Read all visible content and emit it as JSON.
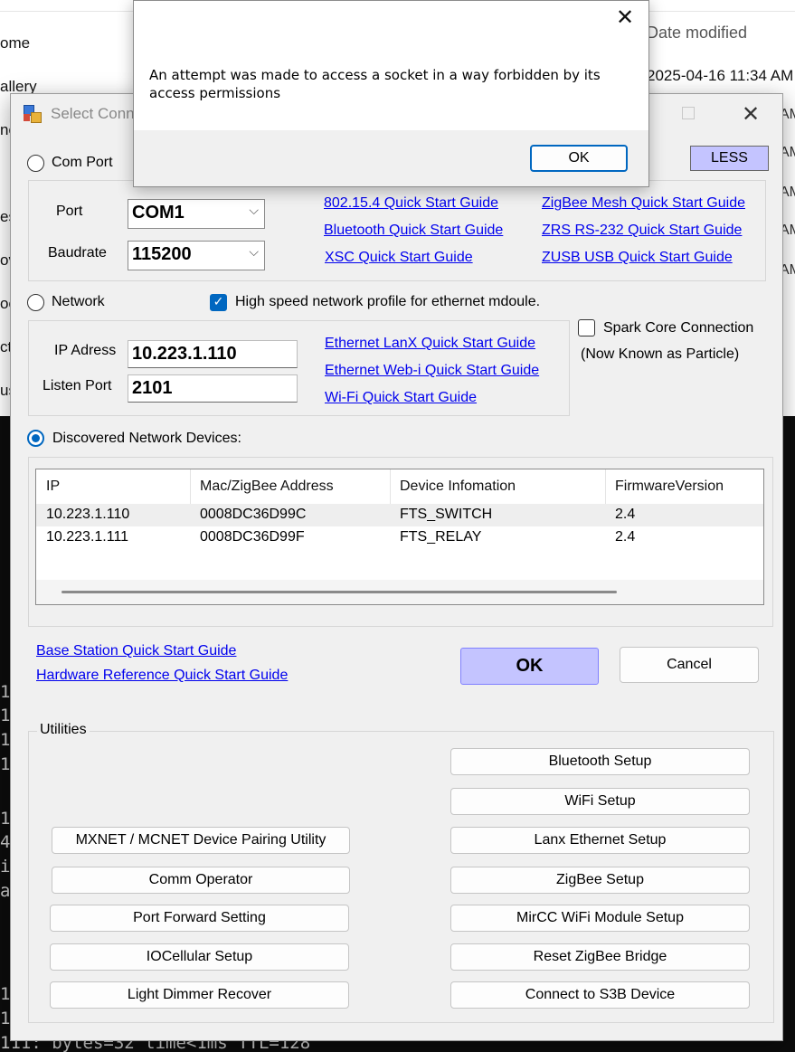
{
  "background": {
    "explorer": {
      "nav_items": [
        "ome",
        "allery",
        "ne",
        "es",
        "ov",
        "oc",
        "ct",
        "us"
      ],
      "column_header": "Date modified",
      "date_value": "2025-04-16 11:34 AM",
      "am_fragments": [
        "AM",
        "AM",
        "AM",
        "AM",
        "AM"
      ]
    },
    "console": {
      "lines": [
        "1",
        "1",
        "1",
        "1",
        "1",
        "4",
        "i",
        "a",
        "1",
        "1",
        "111: bytes=32 time<1ms TTL=128"
      ]
    }
  },
  "dialog": {
    "title": "Select Conn",
    "less_label": "LESS",
    "com_port": {
      "label": "Com Port",
      "selected": false,
      "port_label": "Port",
      "port_value": "COM1",
      "baud_label": "Baudrate",
      "baud_value": "115200"
    },
    "com_links": [
      "802.15.4 Quick Start Guide",
      "Bluetooth Quick Start Guide",
      "XSC Quick Start Guide",
      "ZigBee Mesh Quick Start Guide",
      "ZRS RS-232 Quick Start Guide",
      "ZUSB USB Quick Start Guide"
    ],
    "network": {
      "label": "Network",
      "selected": false,
      "high_speed_label": "High speed network profile for ethernet mdoule.",
      "high_speed_checked": true,
      "ip_label": "IP Adress",
      "ip_value": "10.223.1.110",
      "listen_label": "Listen Port",
      "listen_value": "2101",
      "links": [
        "Ethernet LanX Quick Start Guide",
        "Ethernet Web-i Quick Start Guide",
        "Wi-Fi Quick Start Guide"
      ],
      "spark_label": "Spark Core Connection",
      "spark_sub": "(Now Known as Particle)",
      "spark_checked": false
    },
    "discovered": {
      "label": "Discovered Network Devices:",
      "selected": true,
      "columns": [
        "IP",
        "Mac/ZigBee Address",
        "Device Infomation",
        "FirmwareVersion"
      ],
      "rows": [
        {
          "ip": "10.223.1.110",
          "mac": "0008DC36D99C",
          "info": "FTS_SWITCH",
          "fw": "2.4"
        },
        {
          "ip": "10.223.1.111",
          "mac": "0008DC36D99F",
          "info": "FTS_RELAY",
          "fw": "2.4"
        }
      ]
    },
    "bottom_links": [
      "Base Station Quick Start Guide",
      "Hardware Reference Quick Start Guide"
    ],
    "ok_label": "OK",
    "cancel_label": "Cancel",
    "utilities": {
      "caption": "Utilities",
      "left_buttons": [
        "MXNET / MCNET Device Pairing Utility",
        "Comm Operator",
        "Port Forward Setting",
        "IOCellular Setup",
        "Light Dimmer Recover"
      ],
      "right_buttons": [
        "Bluetooth Setup",
        "WiFi Setup",
        "Lanx Ethernet Setup",
        "ZigBee Setup",
        "MirCC WiFi Module Setup",
        "Reset ZigBee Bridge",
        "Connect to S3B Device"
      ]
    }
  },
  "error": {
    "message": "An attempt was made to access a socket in a way forbidden by its access permissions",
    "ok_label": "OK"
  },
  "colors": {
    "accent": "#0067c0",
    "link": "#0000ee",
    "ok_highlight": "#c4c4ff",
    "dialog_bg": "#f0f0f0"
  }
}
